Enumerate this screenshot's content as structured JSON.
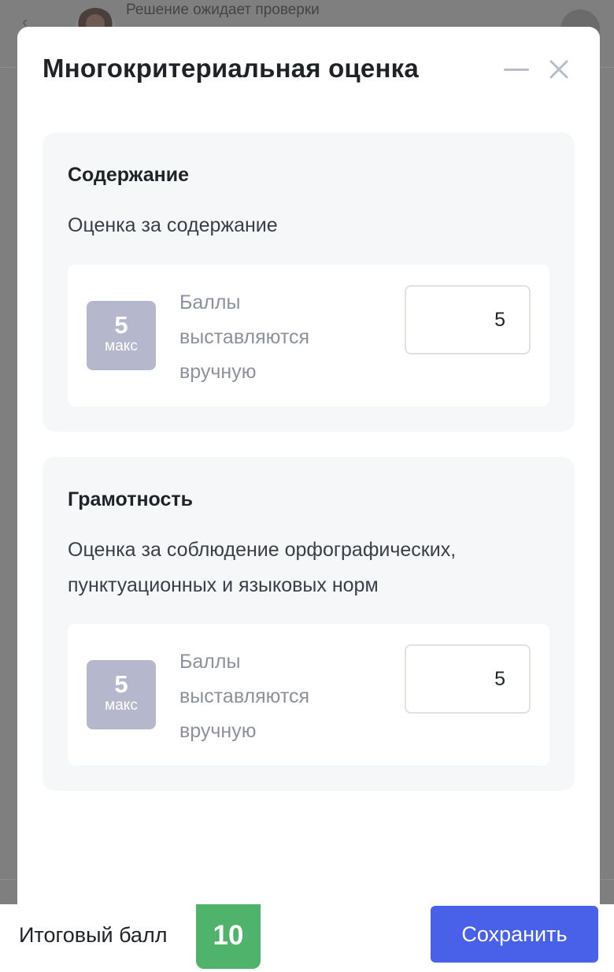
{
  "background": {
    "status_text": "Решение ожидает проверки"
  },
  "modal": {
    "title": "Многокритериальная оценка",
    "criteria": [
      {
        "title": "Содержание",
        "description": "Оценка за содержание",
        "max_value": "5",
        "max_label": "макс",
        "note": "Баллы выставляются вручную",
        "score_value": "5"
      },
      {
        "title": "Грамотность",
        "description": "Оценка за соблюдение орфографических, пунктуационных и языковых норм",
        "max_value": "5",
        "max_label": "макс",
        "note": "Баллы выставляются вручную",
        "score_value": "5"
      }
    ]
  },
  "footer": {
    "total_label": "Итоговый балл",
    "total_value": "10",
    "save_label": "Сохранить"
  },
  "colors": {
    "accent": "#4961e9",
    "total_badge": "#4fb36b",
    "max_badge": "#b5b8cc",
    "overlay": "#7f7f80"
  },
  "icons": {
    "back": "chevron-left-icon",
    "minimize": "minimize-icon",
    "close": "close-icon"
  }
}
